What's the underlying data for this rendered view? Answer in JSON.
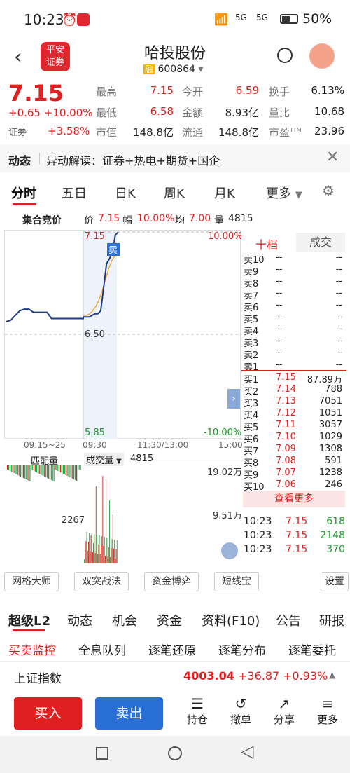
{
  "status": {
    "time": "10:23",
    "battery": "50%",
    "net1": "5G",
    "net2": "5G"
  },
  "header": {
    "title": "哈投股份",
    "badge": "融",
    "code": "600864",
    "logo_l1": "平安",
    "logo_l2": "证券"
  },
  "quote": {
    "price": "7.15",
    "change": "+0.65",
    "pct": "+10.00%",
    "sector_label": "证券",
    "sector_pct": "+3.58%",
    "fields": [
      {
        "label": "最高",
        "value": "7.15"
      },
      {
        "label": "今开",
        "value": "6.59"
      },
      {
        "label": "换手",
        "value": "6.13%"
      },
      {
        "label": "最低",
        "value": "6.58"
      },
      {
        "label": "金额",
        "value": "8.93亿"
      },
      {
        "label": "量比",
        "value": "10.68"
      },
      {
        "label": "市值",
        "value": "148.8亿"
      },
      {
        "label": "流通",
        "value": "148.8亿"
      },
      {
        "label": "市盈",
        "value": "23.96"
      }
    ],
    "pe_sup": "TTM"
  },
  "news": {
    "label": "动态",
    "text": "异动解读：证券+热电+期货+国企"
  },
  "tabs": [
    "分时",
    "五日",
    "日K",
    "周K",
    "月K",
    "更多"
  ],
  "auction": {
    "title": "集合竞价",
    "price_label": "价",
    "price": "7.15",
    "amp_label": "幅",
    "amp": "10.00%",
    "avg_label": "均",
    "avg": "7.00",
    "vol_label": "量",
    "vol": "4815"
  },
  "chart": {
    "top_price": "7.15",
    "mid_price": "6.50",
    "bottom_price": "5.85",
    "top_pct": "10.00%",
    "bottom_pct": "-10.00%",
    "sell_tag": "卖",
    "times": [
      "09:15~25",
      "09:30",
      "11:30/13:00",
      "15:00"
    ],
    "vol_left_label": "匹配量",
    "vol_sel_label": "成交量",
    "vol_value": "4815",
    "vol_max": "19.02万",
    "vol_mid": "9.51万",
    "vol_left_mark": "2267"
  },
  "chart_data": {
    "type": "line",
    "ylim": [
      5.85,
      7.15
    ],
    "series": [
      {
        "values": [
          6.58,
          6.59,
          6.62,
          6.65,
          6.66,
          6.66,
          6.64,
          6.64,
          6.64,
          6.64,
          6.6,
          6.6,
          6.6,
          6.6,
          6.6,
          6.6,
          6.6,
          6.6,
          6.61,
          6.61,
          6.61,
          6.62,
          6.63,
          6.63,
          6.65,
          6.8,
          6.95,
          6.98,
          7.03,
          7.13,
          7.15
        ]
      },
      {
        "values": [
          6.62,
          6.62,
          6.63,
          6.65,
          6.68,
          6.72,
          6.78,
          6.85,
          6.92,
          6.97,
          7.0,
          7.05
        ]
      }
    ]
  },
  "orderbook": {
    "tab1": "十档",
    "tab2": "成交",
    "sells": [
      {
        "label": "卖10",
        "price": "--",
        "vol": "--"
      },
      {
        "label": "卖9",
        "price": "--",
        "vol": "--"
      },
      {
        "label": "卖8",
        "price": "--",
        "vol": "--"
      },
      {
        "label": "卖7",
        "price": "--",
        "vol": "--"
      },
      {
        "label": "卖6",
        "price": "--",
        "vol": "--"
      },
      {
        "label": "卖5",
        "price": "--",
        "vol": "--"
      },
      {
        "label": "卖4",
        "price": "--",
        "vol": "--"
      },
      {
        "label": "卖3",
        "price": "--",
        "vol": "--"
      },
      {
        "label": "卖2",
        "price": "--",
        "vol": "--"
      },
      {
        "label": "卖1",
        "price": "--",
        "vol": "--"
      }
    ],
    "buys": [
      {
        "label": "买1",
        "price": "7.15",
        "vol": "87.89万"
      },
      {
        "label": "买2",
        "price": "7.14",
        "vol": "788"
      },
      {
        "label": "买3",
        "price": "7.13",
        "vol": "7051"
      },
      {
        "label": "买4",
        "price": "7.12",
        "vol": "1051"
      },
      {
        "label": "买5",
        "price": "7.11",
        "vol": "3057"
      },
      {
        "label": "买6",
        "price": "7.10",
        "vol": "1029"
      },
      {
        "label": "买7",
        "price": "7.09",
        "vol": "1308"
      },
      {
        "label": "买8",
        "price": "7.08",
        "vol": "591"
      },
      {
        "label": "买9",
        "price": "7.07",
        "vol": "1238"
      },
      {
        "label": "买10",
        "price": "7.06",
        "vol": "246"
      }
    ],
    "more": "查看更多",
    "trades": [
      {
        "time": "10:23",
        "price": "7.15",
        "vol": "618"
      },
      {
        "time": "10:23",
        "price": "7.15",
        "vol": "2148"
      },
      {
        "time": "10:23",
        "price": "7.15",
        "vol": "370"
      }
    ]
  },
  "tools": [
    "网格大师",
    "双突战法",
    "资金博弈",
    "短线宝",
    "设置"
  ],
  "l2tabs": [
    "超级L2",
    "动态",
    "机会",
    "资金",
    "资料(F10)",
    "公告",
    "研报"
  ],
  "subtabs": [
    "买卖监控",
    "全息队列",
    "逐笔还原",
    "逐笔分布",
    "逐笔委托"
  ],
  "index": {
    "name": "上证指数",
    "value": "4003.04",
    "change": "+36.87",
    "pct": "+0.93%"
  },
  "bottom": {
    "buy": "买入",
    "sell": "卖出",
    "items": [
      "持仓",
      "撤单",
      "分享",
      "更多"
    ]
  }
}
